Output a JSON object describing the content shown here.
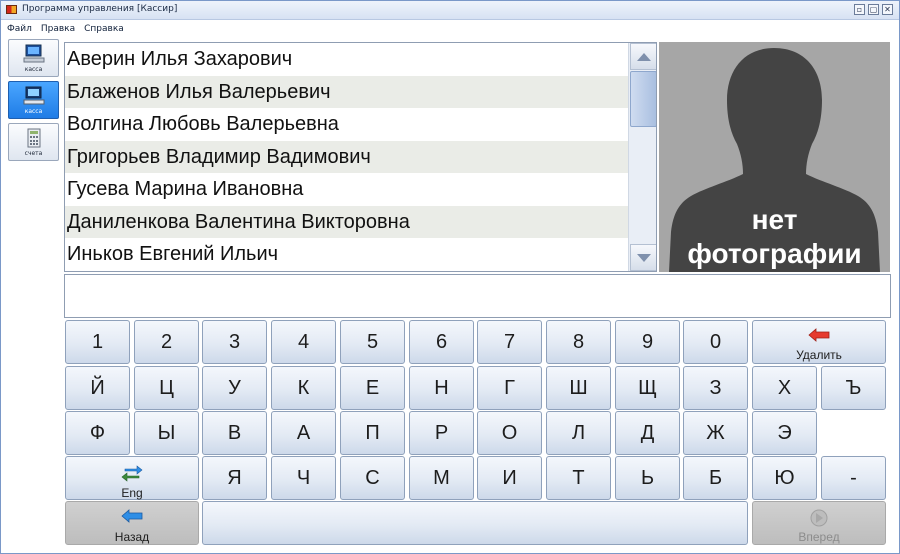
{
  "window": {
    "title": "Программа управления [Кассир]",
    "controls": [
      "▫",
      "▢",
      "✕"
    ]
  },
  "menu": [
    "Файл",
    "Правка",
    "Справка"
  ],
  "sidebar": [
    {
      "label": "касса",
      "icon": "computer-icon",
      "active": false
    },
    {
      "label": "касса",
      "icon": "computer-icon",
      "active": true
    },
    {
      "label": "счета",
      "icon": "calculator-icon",
      "active": false
    }
  ],
  "names": [
    "Аверин Илья Захарович",
    "Блаженов Илья Валерьевич",
    "Волгина Любовь Валерьевна",
    "Григорьев Владимир Вадимович",
    "Гусева Марина Ивановна",
    "Даниленкова Валентина Викторовна",
    "Иньков Евгений Ильич"
  ],
  "photo": {
    "line1": "нет",
    "line2": "фотографии",
    "icon": "person-silhouette-icon"
  },
  "entry": {
    "value": ""
  },
  "keys": {
    "row1": [
      "1",
      "2",
      "3",
      "4",
      "5",
      "6",
      "7",
      "8",
      "9",
      "0"
    ],
    "row2": [
      "Й",
      "Ц",
      "У",
      "К",
      "Е",
      "Н",
      "Г",
      "Ш",
      "Щ",
      "З",
      "Х",
      "Ъ"
    ],
    "row3": [
      "Ф",
      "Ы",
      "В",
      "А",
      "П",
      "Р",
      "О",
      "Л",
      "Д",
      "Ж",
      "Э"
    ],
    "row4": [
      "Я",
      "Ч",
      "С",
      "М",
      "И",
      "Т",
      "Ь",
      "Б",
      "Ю",
      "-"
    ],
    "delete": "Удалить",
    "lang": "Eng",
    "back": "Назад",
    "forward": "Вперед"
  },
  "colors": {
    "accent_red": "#e63a2e",
    "accent_blue": "#2e8ee6"
  }
}
